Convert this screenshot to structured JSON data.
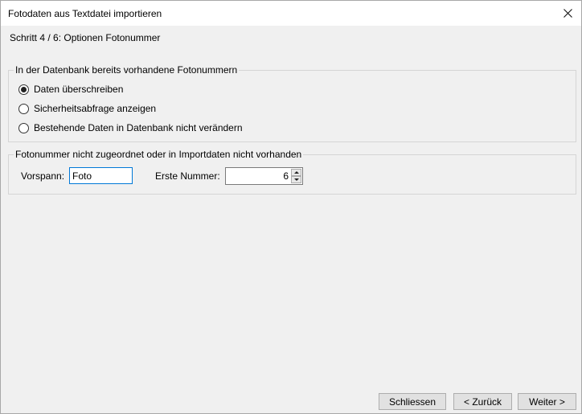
{
  "window": {
    "title": "Fotodaten aus Textdatei importieren",
    "close_icon": "close-icon"
  },
  "step_label": "Schritt 4 / 6: Optionen Fotonummer",
  "existing_group": {
    "legend": "In der Datenbank bereits vorhandene Fotonummern",
    "options": [
      {
        "label": "Daten überschreiben",
        "selected": true
      },
      {
        "label": "Sicherheitsabfrage anzeigen",
        "selected": false
      },
      {
        "label": "Bestehende Daten in Datenbank nicht verändern",
        "selected": false
      }
    ]
  },
  "unassigned_group": {
    "legend": "Fotonummer nicht zugeordnet oder in Importdaten nicht vorhanden",
    "prefix_label": "Vorspann:",
    "prefix_value": "Foto",
    "first_number_label": "Erste Nummer:",
    "first_number_value": "6"
  },
  "buttons": {
    "close": "Schliessen",
    "back": "< Zurück",
    "next": "Weiter >"
  }
}
